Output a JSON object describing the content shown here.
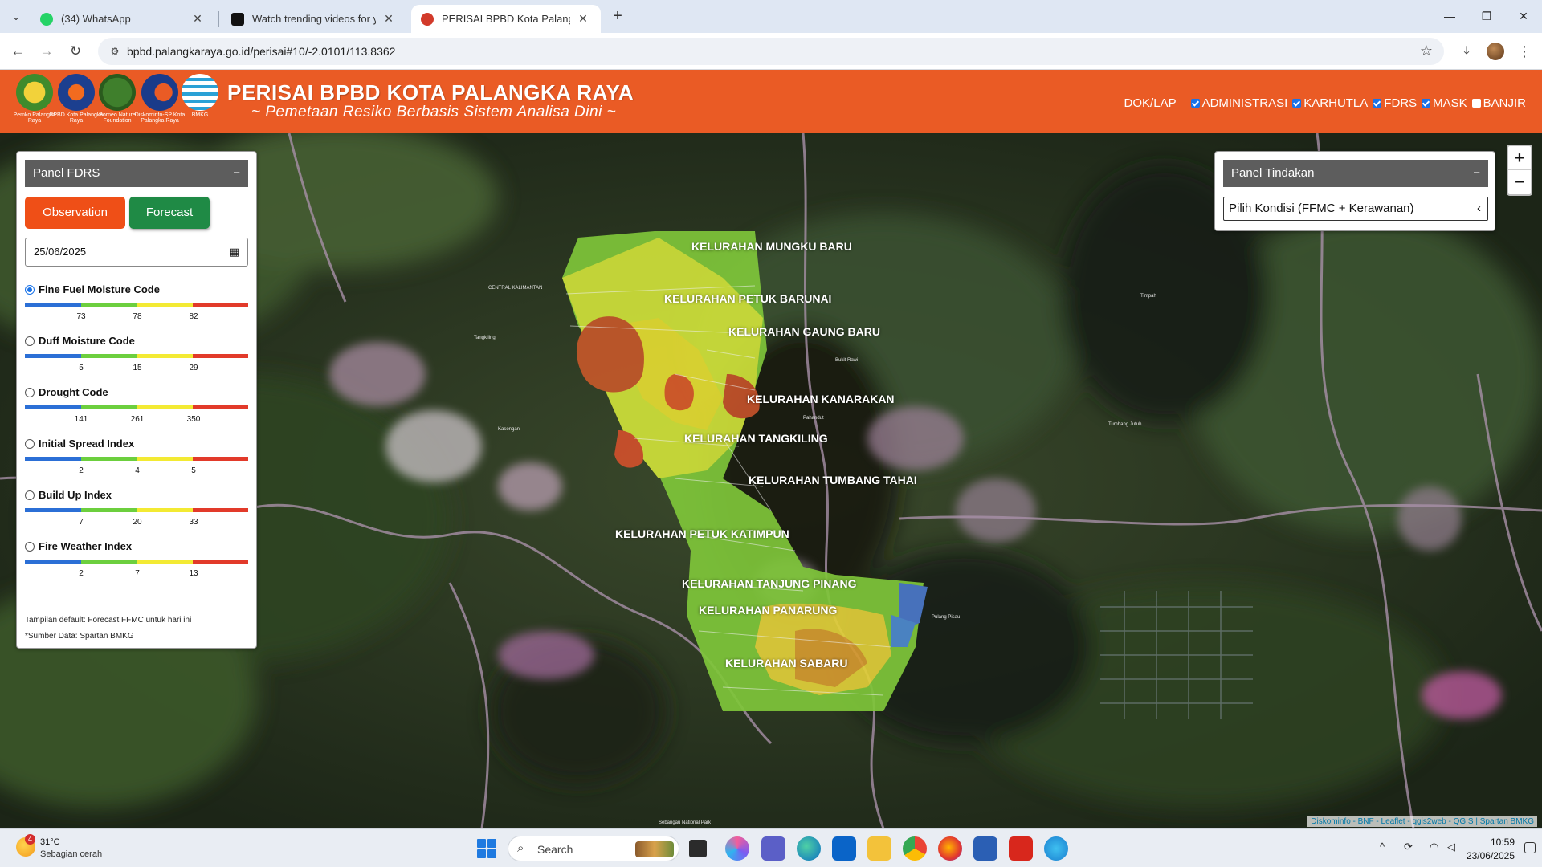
{
  "browser": {
    "tabs": [
      {
        "title": "(34) WhatsApp",
        "active": false
      },
      {
        "title": "Watch trending videos for you | TikTok",
        "active": false
      },
      {
        "title": "PERISAI BPBD Kota Palangka Raya",
        "active": true
      }
    ],
    "url": "bpbd.palangkaraya.go.id/perisai#10/-2.0101/113.8362"
  },
  "header": {
    "title": "PERISAI BPBD KOTA PALANGKA RAYA",
    "subtitle": "~ Pemetaan Resiko Berbasis Sistem Analisa Dini ~",
    "logos": [
      {
        "icon": "pemko-logo",
        "caption": "Pemko Palangka Raya"
      },
      {
        "icon": "bpbd-logo",
        "caption": "BPBD Kota Palangka Raya"
      },
      {
        "icon": "borneo-nature-logo",
        "caption": "Borneo Nature Foundation"
      },
      {
        "icon": "diskominfo-logo",
        "caption": "Diskominfo-SP Kota Palangka Raya"
      },
      {
        "icon": "bmkg-logo",
        "caption": "BMKG"
      }
    ],
    "nav_link": "DOK/LAP",
    "layers": [
      {
        "label": "ADMINISTRASI",
        "checked": true
      },
      {
        "label": "KARHUTLA",
        "checked": true
      },
      {
        "label": "FDRS",
        "checked": true
      },
      {
        "label": "MASK",
        "checked": true
      },
      {
        "label": "BANJIR",
        "checked": false
      }
    ]
  },
  "fdrs_panel": {
    "title": "Panel FDRS",
    "minimize": "−",
    "observation_label": "Observation",
    "forecast_label": "Forecast",
    "date_value": "25/06/2025",
    "scale_colors": [
      "#2b6fd6",
      "#6ccf3e",
      "#f3ea33",
      "#e23a2a"
    ],
    "indices": [
      {
        "name": "Fine Fuel Moisture Code",
        "selected": true,
        "ticks": [
          "73",
          "78",
          "82"
        ]
      },
      {
        "name": "Duff Moisture Code",
        "selected": false,
        "ticks": [
          "5",
          "15",
          "29"
        ]
      },
      {
        "name": "Drought Code",
        "selected": false,
        "ticks": [
          "141",
          "261",
          "350"
        ]
      },
      {
        "name": "Initial Spread Index",
        "selected": false,
        "ticks": [
          "2",
          "4",
          "5"
        ]
      },
      {
        "name": "Build Up Index",
        "selected": false,
        "ticks": [
          "7",
          "20",
          "33"
        ]
      },
      {
        "name": "Fire Weather Index",
        "selected": false,
        "ticks": [
          "2",
          "7",
          "13"
        ]
      }
    ],
    "note_default": "Tampilan default: Forecast FFMC untuk hari ini",
    "note_source": "*Sumber Data: Spartan BMKG"
  },
  "action_panel": {
    "title": "Panel Tindakan",
    "minimize": "−",
    "select_value": "Pilih Kondisi (FFMC + Kerawanan)"
  },
  "map": {
    "zoom_in": "+",
    "zoom_out": "−",
    "attribution": "Diskominfo - BNF - Leaflet - qgis2web - QGIS | Spartan BMKG",
    "kelurahan": [
      "KELURAHAN MUNGKU BARU",
      "KELURAHAN PETUK BARUNAI",
      "KELURAHAN GAUNG BARU",
      "KELURAHAN KANARAKAN",
      "KELURAHAN TANGKILING",
      "KELURAHAN TUMBANG TAHAI",
      "KELURAHAN PETUK KATIMPUN",
      "KELURAHAN TANJUNG PINANG",
      "KELURAHAN PANARUNG",
      "KELURAHAN SABARU"
    ],
    "small_labels": [
      "CENTRAL KALIMANTAN",
      "Tangkiling",
      "Kasongan",
      "Bukit Rawi",
      "Pahandut",
      "Tumbang Jutuh",
      "Timpah",
      "Pulang Pisau",
      "Sebangau National Park"
    ]
  },
  "taskbar": {
    "temperature": "31°C",
    "weather": "Sebagian cerah",
    "weather_badge": "4",
    "search_label": "Search",
    "time": "10:59",
    "date": "23/06/2025"
  }
}
